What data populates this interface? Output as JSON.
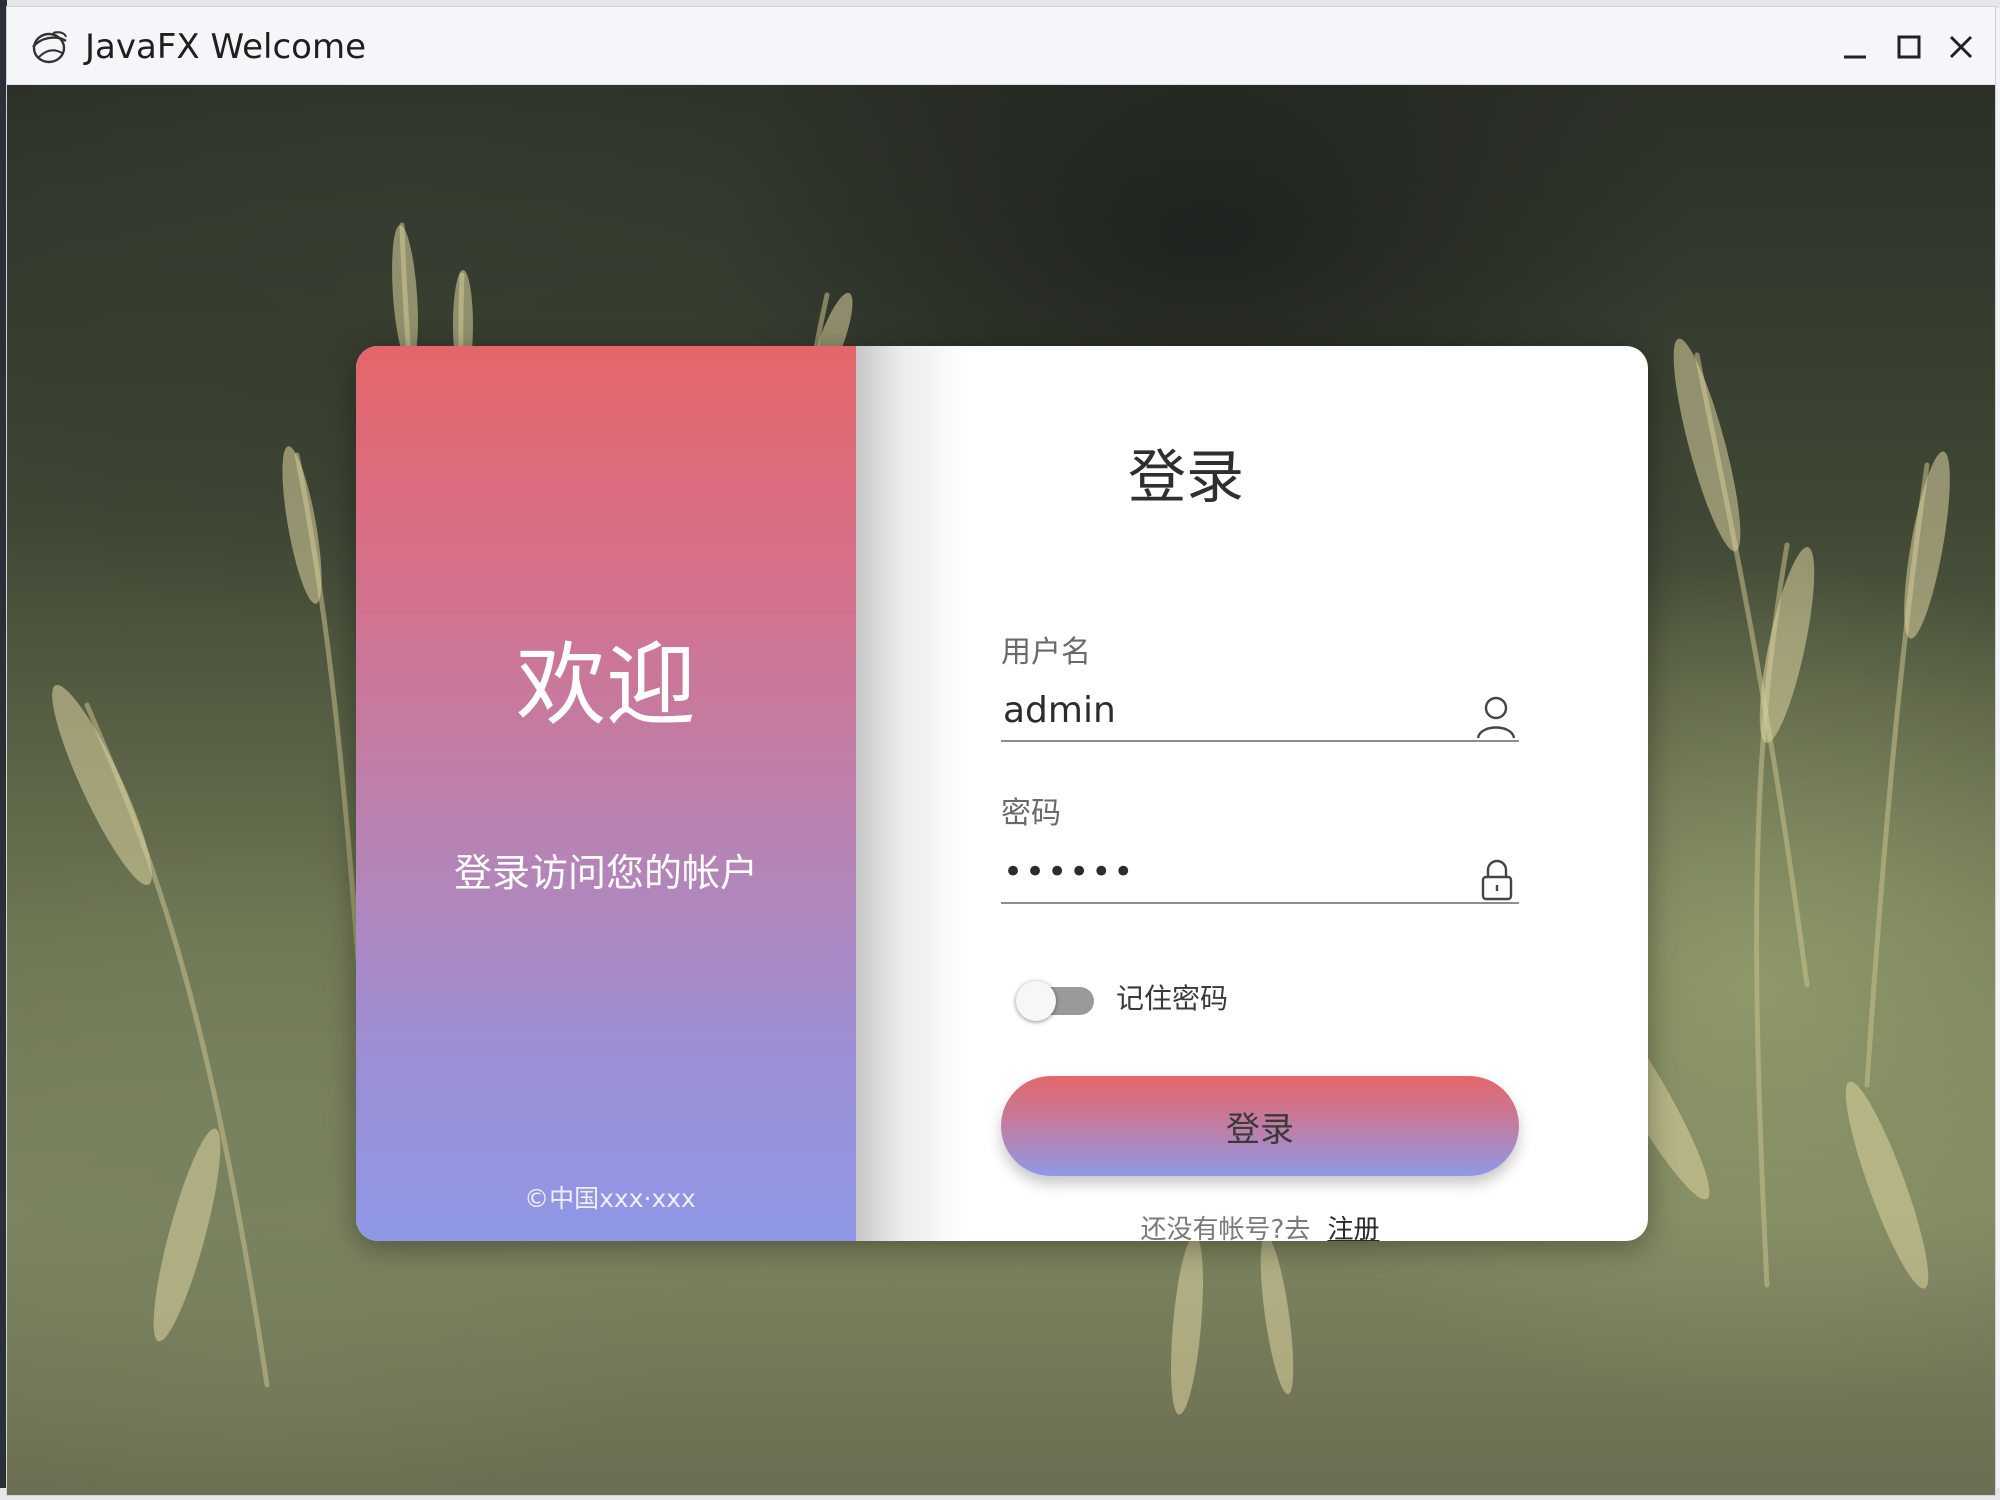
{
  "window": {
    "title": "JavaFX Welcome"
  },
  "icons": {
    "app": "javafx-app-icon",
    "minimize": "minimize-icon",
    "maximize": "maximize-icon",
    "close": "close-icon",
    "user": "user-icon",
    "lock": "lock-icon"
  },
  "colors": {
    "gradient_top": "#e4666a",
    "gradient_bottom": "#8f98e6",
    "card_background": "#ffffff",
    "toggle_off": "#9a9a9a"
  },
  "welcome": {
    "title": "欢迎",
    "subtitle": "登录访问您的帐户",
    "copyright": "©中国xxx·xxx"
  },
  "login": {
    "title": "登录",
    "username_label": "用户名",
    "username_value": "admin",
    "password_label": "密码",
    "password_value": "••••••",
    "remember_label": "记住密码",
    "remember_checked": false,
    "submit_label": "登录",
    "register_hint": "还没有帐号?去",
    "register_link": "注册"
  }
}
